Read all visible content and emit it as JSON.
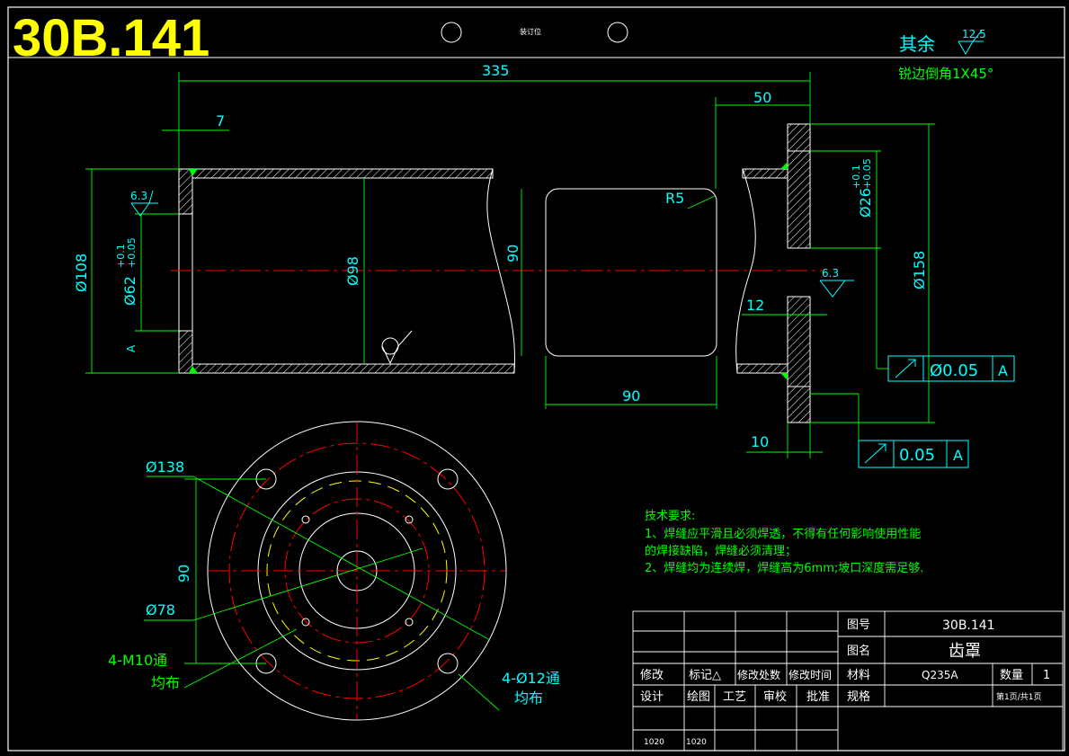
{
  "drawing_number": "30B.141",
  "binding_label": "装订位",
  "surface_finish": {
    "other_label": "其余",
    "other_value": "12.5",
    "chamfer_note": "锐边倒角1X45°",
    "local_values": [
      "6.3",
      "6.3"
    ]
  },
  "dimensions": {
    "overall_length": "335",
    "flange_offset": "50",
    "wall_thickness": "7",
    "outer_diameter": "Ø108",
    "bore_diameter": "Ø62",
    "bore_tol_upper": "+0.1",
    "bore_tol_lower": "+0.05",
    "inner_diameter": "Ø98",
    "window_height": "90",
    "window_width": "90",
    "corner_radius": "R5",
    "flange_bore": "Ø26",
    "flange_bore_tol_upper": "+0.1",
    "flange_bore_tol_lower": "+0.05",
    "flange_diameter": "Ø158",
    "flange_step": "12",
    "flange_thickness": "10",
    "datum_mark": "A"
  },
  "tolerances": [
    {
      "value": "Ø0.05",
      "datum": "A"
    },
    {
      "value": "0.05",
      "datum": "A"
    }
  ],
  "plan_view": {
    "pcd_outer": "Ø138",
    "pcd_inner": "Ø78",
    "spacing": "90",
    "tapped_holes_1": "4-M10通",
    "tapped_holes_2": "均布",
    "through_holes_1": "4-Ø12通",
    "through_holes_2": "均布"
  },
  "tech_requirements": {
    "title": "技术要求:",
    "lines": [
      "1、焊缝应平滑且必须焊透，不得有任何影响使用性能",
      "的焊接缺陷，焊缝必须清理；",
      "2、焊缝均为连续焊，焊缝高为6mm;坡口深度需足够."
    ]
  },
  "title_block": {
    "drawing_no_label": "图号",
    "drawing_no_value": "30B.141",
    "name_label": "图名",
    "name_value": "齿罩",
    "material_label": "材料",
    "material_value": "Q235A",
    "qty_label": "数量",
    "qty_value": "1",
    "spec_label": "规格",
    "page_info": "第1页/共1页",
    "revision_headers": [
      "修改",
      "标记△",
      "修改处数",
      "修改时间"
    ],
    "sign_headers": [
      "设计",
      "绘图",
      "工艺",
      "审校",
      "批准"
    ],
    "dates": [
      "1020",
      "1020"
    ]
  }
}
